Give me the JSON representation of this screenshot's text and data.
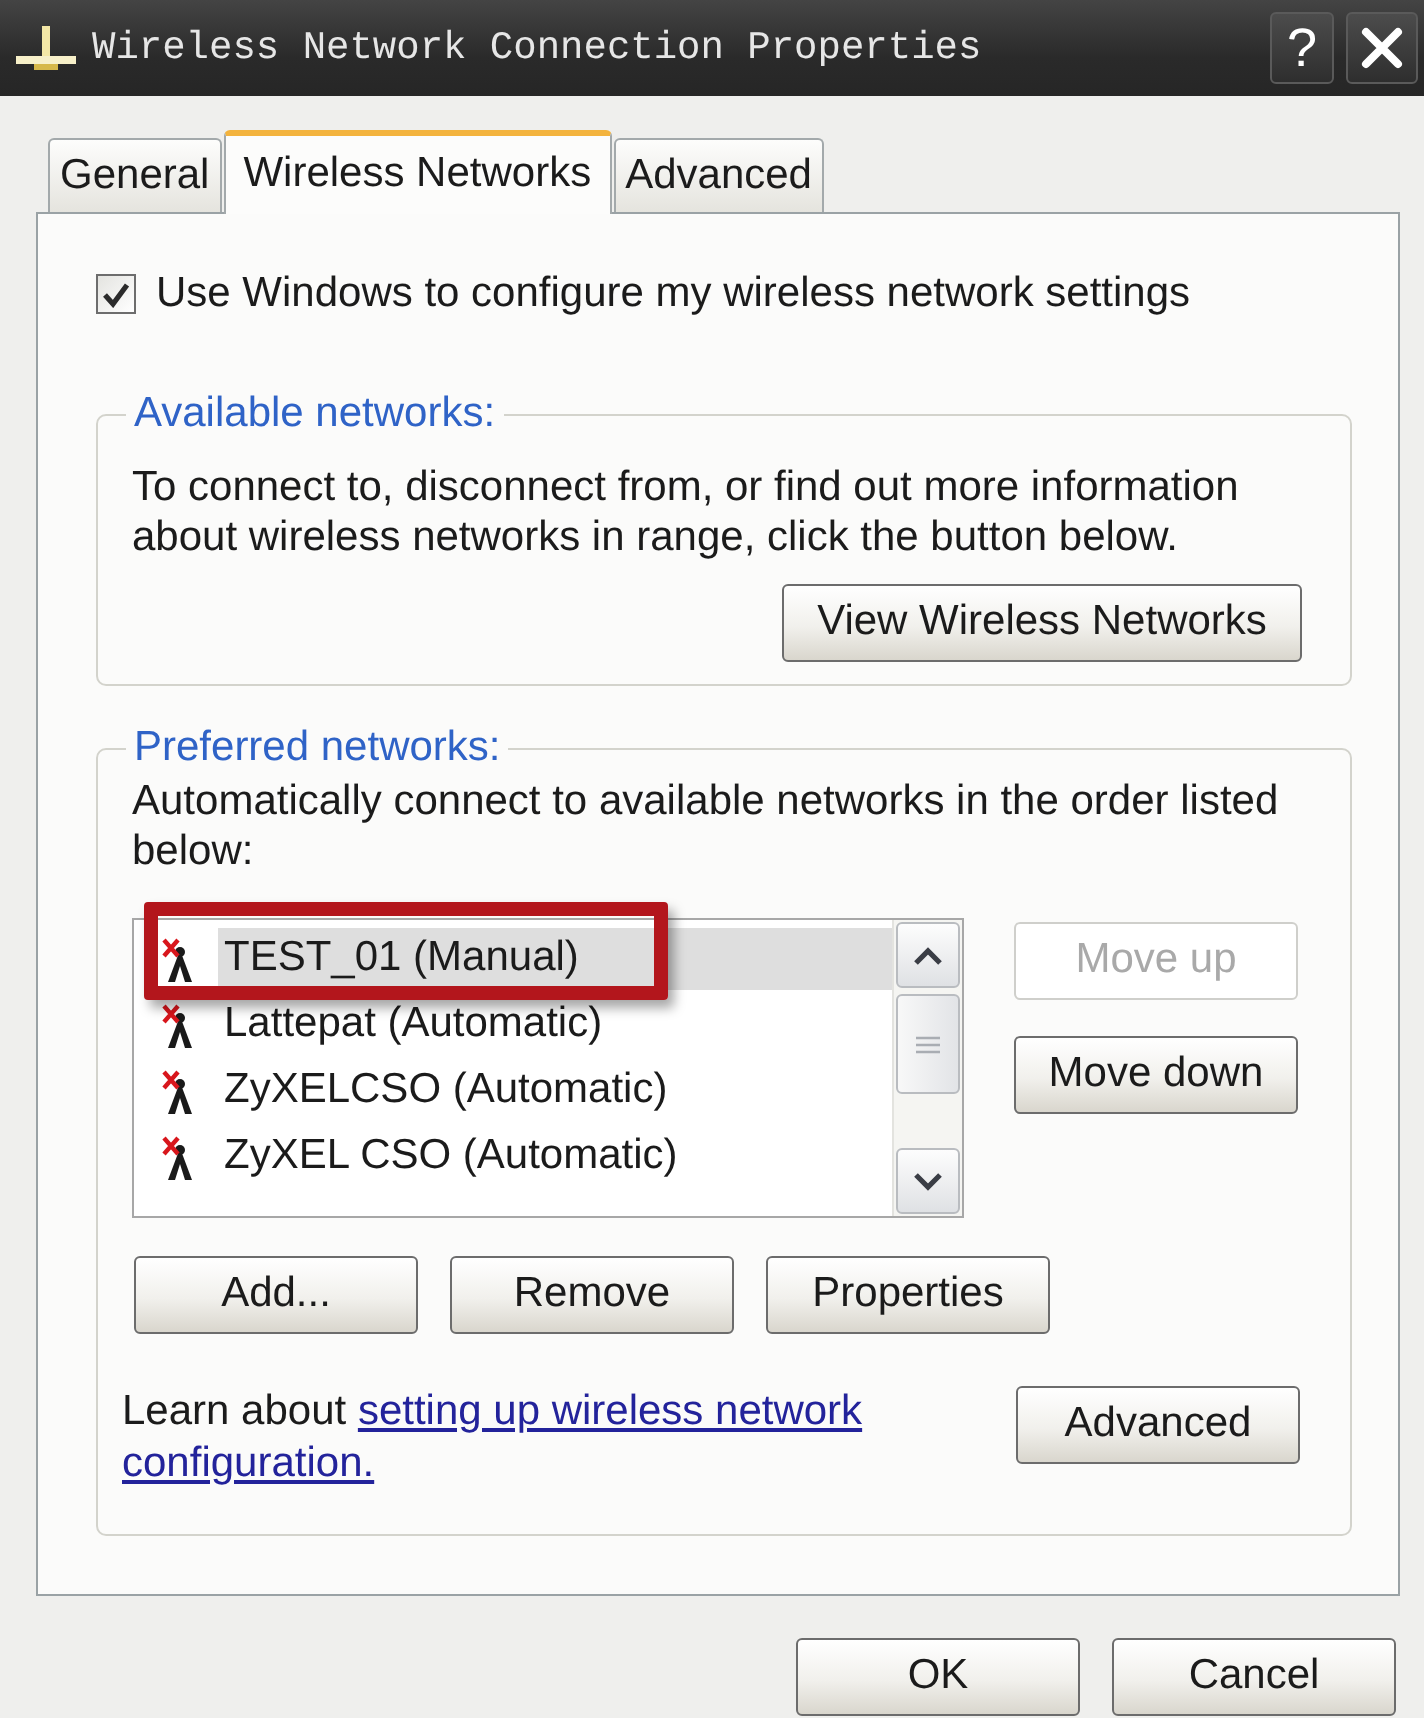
{
  "window": {
    "title": "Wireless Network Connection Properties",
    "help_label": "?"
  },
  "tabs": [
    {
      "label": "General",
      "selected": false
    },
    {
      "label": "Wireless Networks",
      "selected": true
    },
    {
      "label": "Advanced",
      "selected": false
    }
  ],
  "use_windows": {
    "label": "Use Windows to configure my wireless network settings",
    "checked": true
  },
  "available_networks": {
    "legend": "Available networks:",
    "description": "To connect to, disconnect from, or find out more information about wireless networks in range, click the button below.",
    "button": "View Wireless Networks"
  },
  "preferred_networks": {
    "legend": "Preferred networks:",
    "description": "Automatically connect to available networks in the order listed below:",
    "networks": [
      {
        "name": "TEST_01 (Manual)",
        "selected": true,
        "highlighted": true
      },
      {
        "name": "Lattepat (Automatic)",
        "selected": false,
        "highlighted": false
      },
      {
        "name": "ZyXELCSO (Automatic)",
        "selected": false,
        "highlighted": false
      },
      {
        "name": "ZyXEL CSO (Automatic)",
        "selected": false,
        "highlighted": false
      }
    ],
    "order_buttons": [
      {
        "label": "Move up",
        "disabled": true
      },
      {
        "label": "Move down",
        "disabled": false
      }
    ],
    "buttons": [
      "Add...",
      "Remove",
      "Properties"
    ],
    "learn_text": "Learn about",
    "learn_link_lines": [
      "setting up wireless network",
      "configuration."
    ],
    "advanced_button": "Advanced"
  },
  "dialog_buttons": [
    "OK",
    "Cancel"
  ]
}
